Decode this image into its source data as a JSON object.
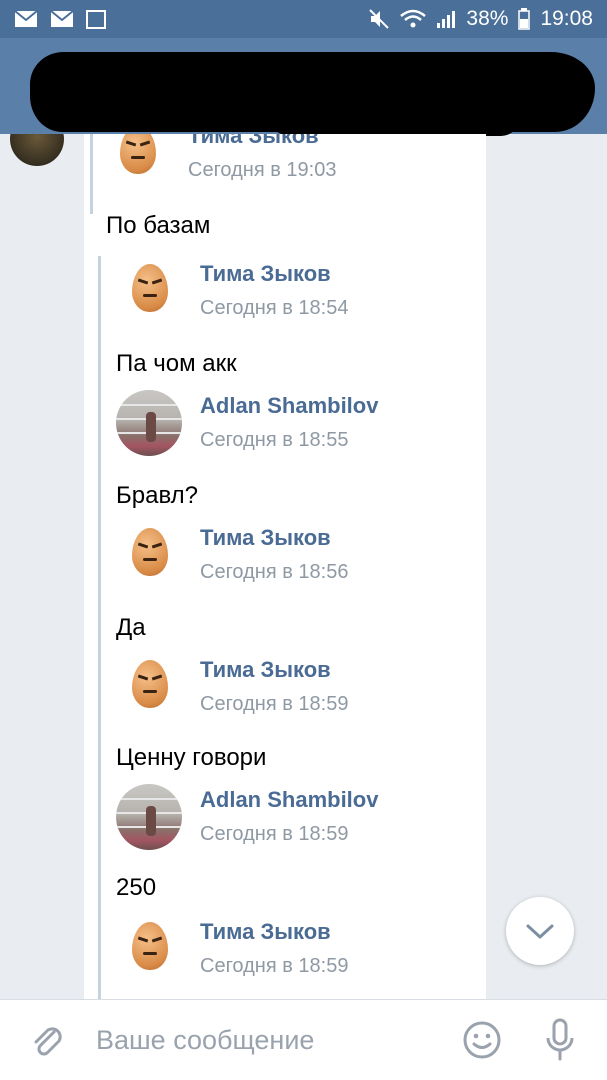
{
  "status_bar": {
    "battery": "38%",
    "time": "19:08"
  },
  "chat": {
    "top_forward": {
      "name": "Тима Зыков",
      "time": "Сегодня в 19:03",
      "text": "По базам"
    },
    "messages": [
      {
        "name": "Тима Зыков",
        "time": "Сегодня в 18:54",
        "text": "Па чом акк",
        "avatar": "egg"
      },
      {
        "name": "Adlan Shambilov",
        "time": "Сегодня в 18:55",
        "text": "Бравл?",
        "avatar": "photo"
      },
      {
        "name": "Тима Зыков",
        "time": "Сегодня в 18:56",
        "text": "Да",
        "avatar": "egg"
      },
      {
        "name": "Тима Зыков",
        "time": "Сегодня в 18:59",
        "text": "Ценну говори",
        "avatar": "egg"
      },
      {
        "name": "Adlan Shambilov",
        "time": "Сегодня в 18:59",
        "text": "250",
        "avatar": "photo"
      },
      {
        "name": "Тима Зыков",
        "time": "Сегодня в 18:59",
        "text": "",
        "avatar": "egg"
      }
    ]
  },
  "compose": {
    "placeholder": "Ваше сообщение"
  },
  "icons": {
    "back": "arrow-left-icon",
    "attach": "paperclip-icon",
    "emoji": "smile-icon",
    "mic": "microphone-icon",
    "scroll_down": "chevron-down-icon"
  }
}
